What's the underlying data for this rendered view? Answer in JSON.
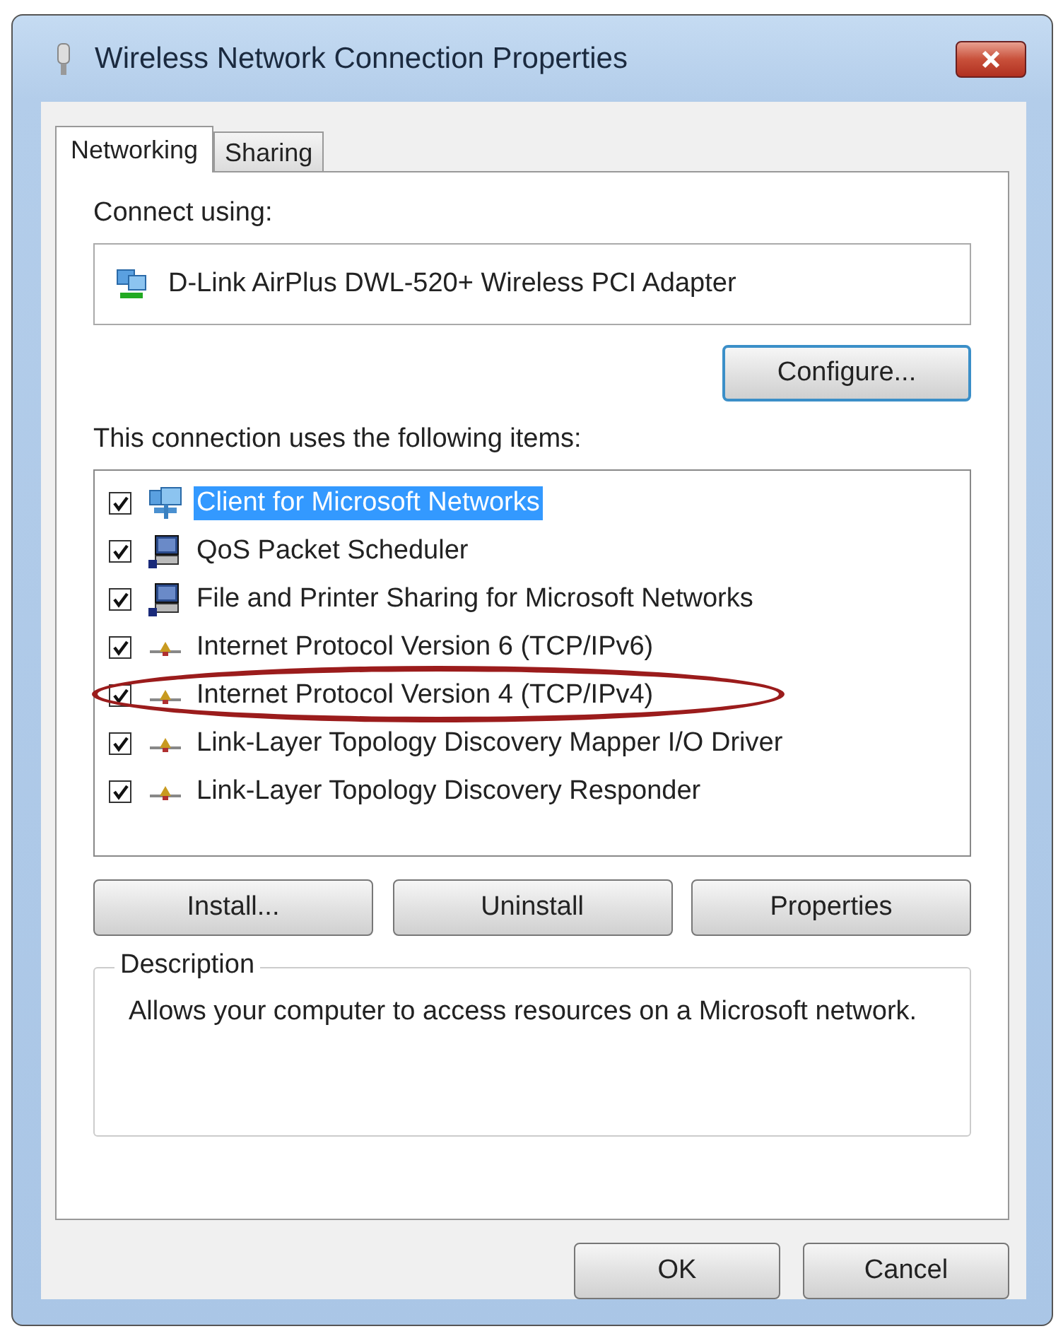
{
  "window": {
    "title": "Wireless Network Connection Properties"
  },
  "tabs": [
    {
      "label": "Networking",
      "selected": true
    },
    {
      "label": "Sharing",
      "selected": false
    }
  ],
  "connect_using": {
    "label": "Connect using:",
    "adapter": "D-Link AirPlus DWL-520+ Wireless PCI Adapter"
  },
  "configure_button": "Configure...",
  "items_label": "This connection uses the following items:",
  "items": [
    {
      "label": "Client for Microsoft Networks",
      "kind": "client",
      "checked": true,
      "selected": true,
      "circled": false
    },
    {
      "label": "QoS Packet Scheduler",
      "kind": "service",
      "checked": true,
      "selected": false,
      "circled": false
    },
    {
      "label": "File and Printer Sharing for Microsoft Networks",
      "kind": "service",
      "checked": true,
      "selected": false,
      "circled": false
    },
    {
      "label": "Internet Protocol Version 6 (TCP/IPv6)",
      "kind": "protocol",
      "checked": true,
      "selected": false,
      "circled": false
    },
    {
      "label": "Internet Protocol Version 4 (TCP/IPv4)",
      "kind": "protocol",
      "checked": true,
      "selected": false,
      "circled": true
    },
    {
      "label": "Link-Layer Topology Discovery Mapper I/O Driver",
      "kind": "protocol",
      "checked": true,
      "selected": false,
      "circled": false
    },
    {
      "label": "Link-Layer Topology Discovery Responder",
      "kind": "protocol",
      "checked": true,
      "selected": false,
      "circled": false
    }
  ],
  "item_buttons": [
    "Install...",
    "Uninstall",
    "Properties"
  ],
  "description": {
    "title": "Description",
    "text": "Allows your computer to access resources on a Microsoft network."
  },
  "dialog_buttons": [
    "OK",
    "Cancel"
  ]
}
